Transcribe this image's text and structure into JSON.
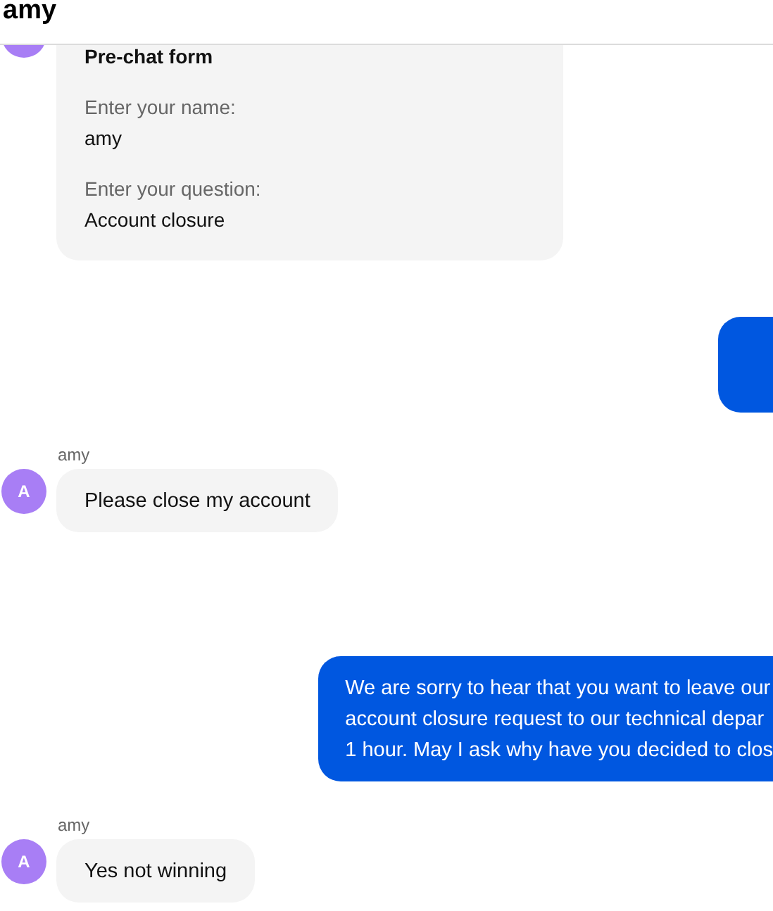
{
  "header": {
    "title": "amy"
  },
  "messages": [
    {
      "kind": "form",
      "title": "Pre-chat form",
      "fields": [
        {
          "label": "Enter your name:",
          "value": "amy"
        },
        {
          "label": "Enter your question:",
          "value": "Account closure"
        }
      ]
    },
    {
      "kind": "outgoing"
    },
    {
      "kind": "incoming",
      "sender": "amy",
      "avatar": "A",
      "text": "Please close my account"
    },
    {
      "kind": "outgoing",
      "lines": [
        "We are sorry to hear that you want to leave our",
        "account closure request to our technical depar",
        "1 hour. May I ask why have you decided to clos"
      ]
    },
    {
      "kind": "incoming",
      "sender": "amy",
      "avatar": "A",
      "text": "Yes not winning"
    }
  ]
}
